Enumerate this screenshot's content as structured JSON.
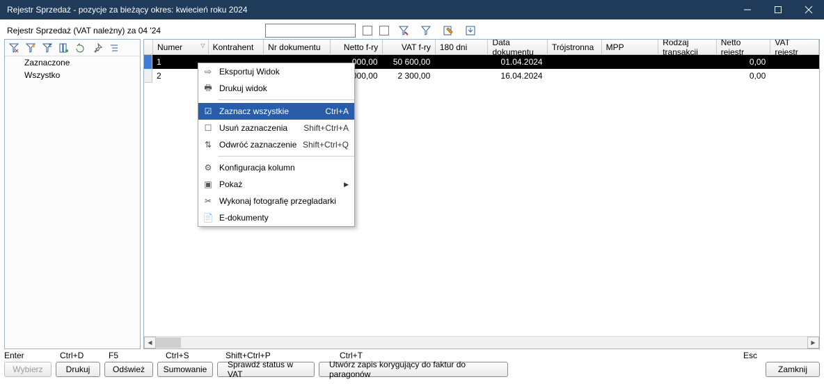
{
  "window": {
    "title": "Rejestr Sprzedaż - pozycje za bieżący okres:  kwiecień  roku 2024"
  },
  "subtitle": "Rejestr Sprzedaż (VAT należny) za 04 '24",
  "tree": {
    "items": [
      "Zaznaczone",
      "Wszystko"
    ]
  },
  "columns": {
    "numer": "Numer",
    "kontrahent": "Kontrahent",
    "nrdok": "Nr dokumentu",
    "netto": "Netto f-ry",
    "vat": "VAT f-ry",
    "d180": "180 dni",
    "data": "Data dokumentu",
    "troj": "Trójstronna",
    "mpp": "MPP",
    "rodzaj": "Rodzaj transakcji",
    "nettorej": "Netto rejestr",
    "vatrej": "VAT rejestr"
  },
  "rows": [
    {
      "numer": "1",
      "kontrahent": "",
      "nrdok": "",
      "netto": "000,00",
      "vat": "50 600,00",
      "d180": "",
      "data": "01.04.2024",
      "troj": "",
      "mpp": "",
      "rodzaj": "",
      "nettorej": "0,00",
      "vatrej": ""
    },
    {
      "numer": "2",
      "kontrahent": "",
      "nrdok": "",
      "netto": "000,00",
      "vat": "2 300,00",
      "d180": "",
      "data": "16.04.2024",
      "troj": "",
      "mpp": "",
      "rodzaj": "",
      "nettorej": "0,00",
      "vatrej": ""
    }
  ],
  "context_menu": {
    "export": "Eksportuj Widok",
    "print": "Drukuj widok",
    "select_all": "Zaznacz wszystkie",
    "select_all_sc": "Ctrl+A",
    "unselect": "Usuń zaznaczenia",
    "unselect_sc": "Shift+Ctrl+A",
    "invert": "Odwróć zaznaczenie",
    "invert_sc": "Shift+Ctrl+Q",
    "config": "Konfiguracja kolumn",
    "show": "Pokaż",
    "photo": "Wykonaj fotografię przegladarki",
    "edocs": "E-dokumenty"
  },
  "shortcuts": {
    "enter": "Enter",
    "ctrld": "Ctrl+D",
    "f5": "F5",
    "ctrls": "Ctrl+S",
    "shiftctrlp": "Shift+Ctrl+P",
    "ctrlt": "Ctrl+T",
    "esc": "Esc"
  },
  "buttons": {
    "wybierz": "Wybierz",
    "drukuj": "Drukuj",
    "odswiez": "Odśwież",
    "sumowanie": "Sumowanie",
    "sprawdz": "Sprawdź status w VAT",
    "utworz": "Utwórz zapis korygujący do faktur do paragonów",
    "zamknij": "Zamknij"
  }
}
